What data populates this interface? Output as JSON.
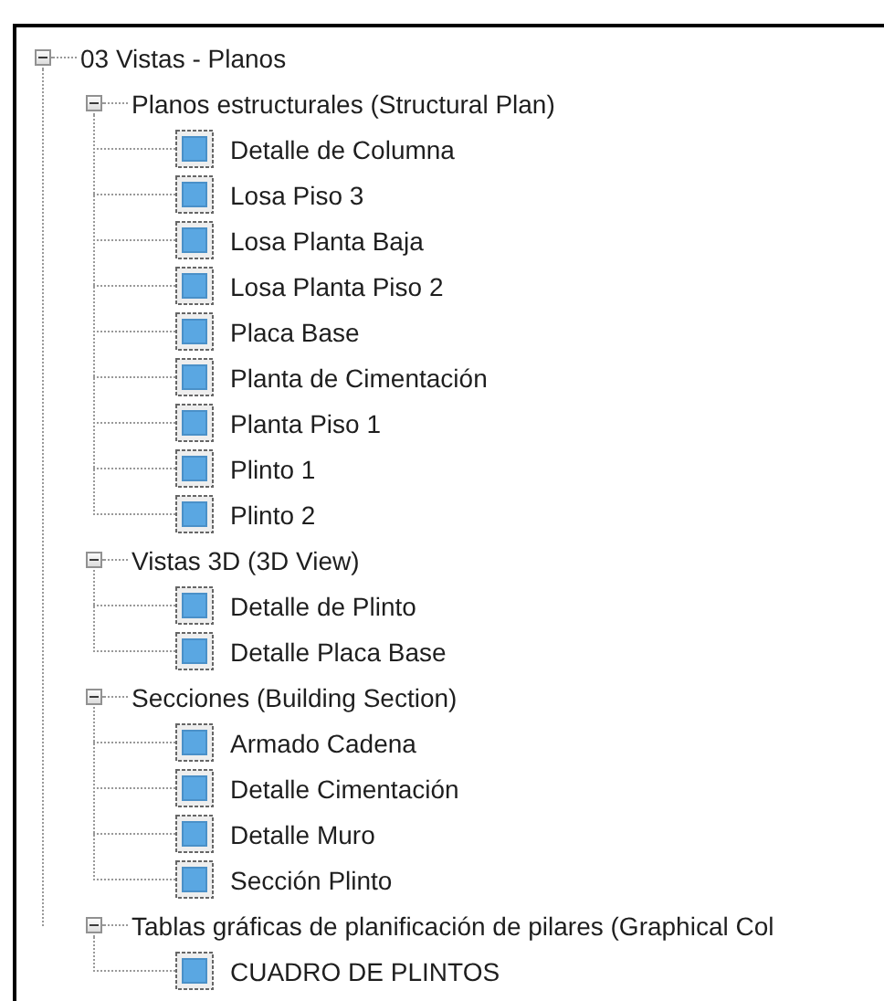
{
  "tree": {
    "label": "03 Vistas - Planos",
    "expanded": true,
    "children": [
      {
        "label": "Planos estructurales (Structural Plan)",
        "expanded": true,
        "children": [
          {
            "label": "Detalle de Columna"
          },
          {
            "label": "Losa Piso 3"
          },
          {
            "label": "Losa Planta Baja"
          },
          {
            "label": "Losa Planta Piso 2"
          },
          {
            "label": "Placa Base"
          },
          {
            "label": "Planta de Cimentación"
          },
          {
            "label": "Planta Piso 1"
          },
          {
            "label": "Plinto 1"
          },
          {
            "label": "Plinto 2"
          }
        ]
      },
      {
        "label": "Vistas 3D (3D View)",
        "expanded": true,
        "children": [
          {
            "label": "Detalle de Plinto"
          },
          {
            "label": "Detalle Placa Base"
          }
        ]
      },
      {
        "label": "Secciones (Building Section)",
        "expanded": true,
        "children": [
          {
            "label": "Armado Cadena"
          },
          {
            "label": "Detalle Cimentación"
          },
          {
            "label": "Detalle Muro"
          },
          {
            "label": "Sección Plinto"
          }
        ]
      },
      {
        "label": "Tablas gráficas de planificación de pilares (Graphical Col",
        "expanded": true,
        "children": [
          {
            "label": "CUADRO DE PLINTOS"
          }
        ]
      }
    ]
  }
}
